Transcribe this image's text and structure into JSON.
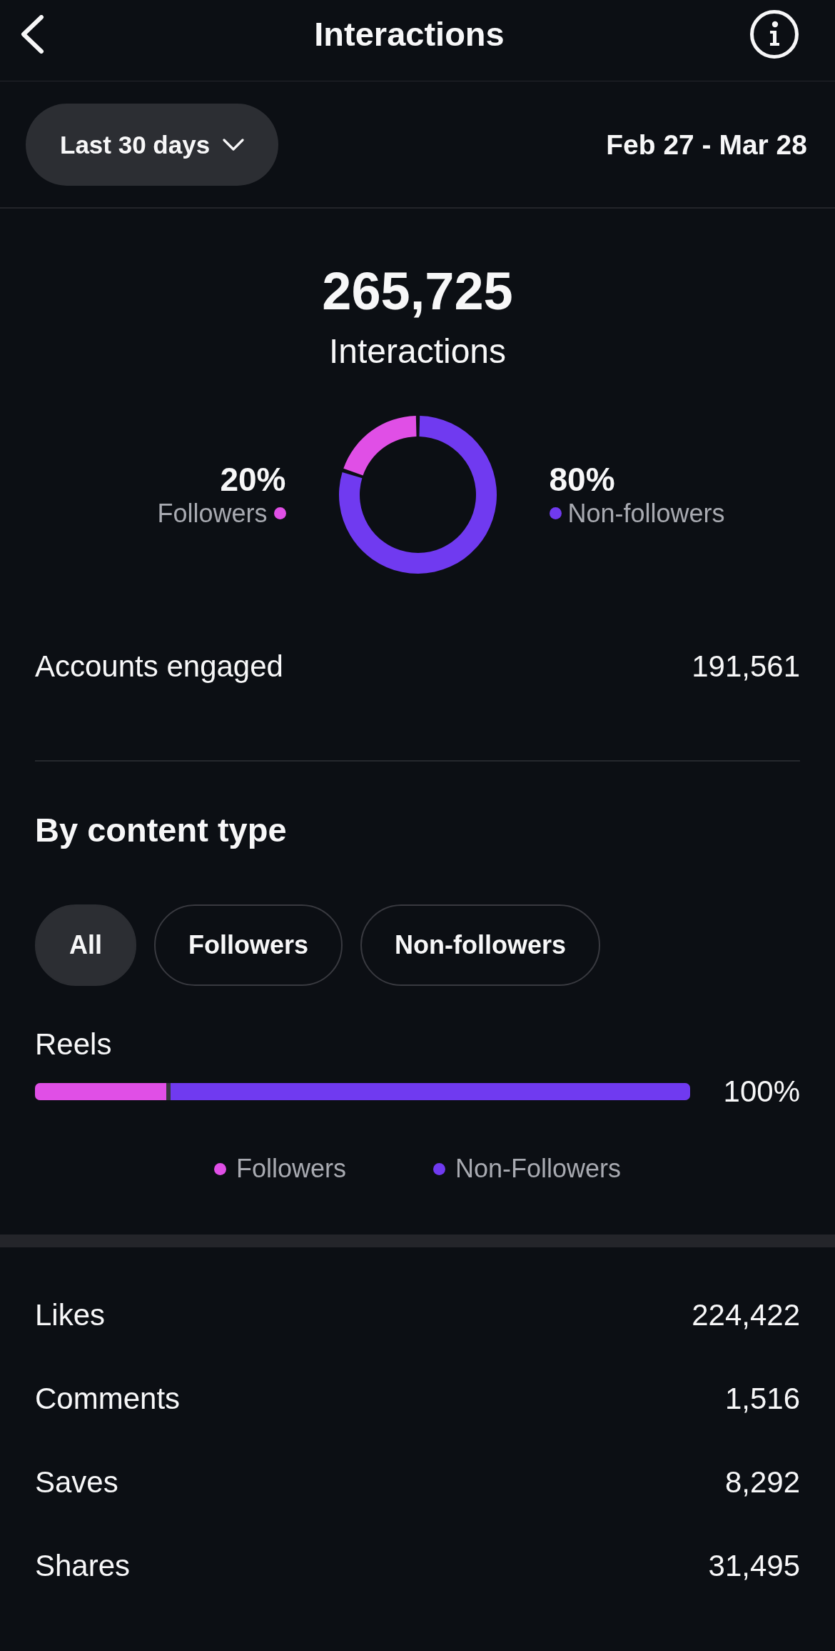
{
  "header": {
    "title": "Interactions"
  },
  "filter": {
    "range": "Last 30 days",
    "dates": "Feb 27 - Mar 28"
  },
  "summary": {
    "total": "265,725",
    "label": "Interactions",
    "chart_data": {
      "type": "donut",
      "categories": [
        "Followers",
        "Non-followers"
      ],
      "values": [
        20,
        80
      ]
    },
    "breakdown": [
      {
        "percent": "20%",
        "color": "#e04fe6"
      },
      {
        "percent": "80%",
        "color": "#703af0"
      }
    ]
  },
  "accounts_engaged": {
    "label": "Accounts engaged",
    "value": "191,561"
  },
  "content_type": {
    "title": "By content type",
    "chips": [
      {
        "label": "All",
        "selected": true
      },
      {
        "label": "Followers",
        "selected": false
      },
      {
        "label": "Non-followers",
        "selected": false
      }
    ],
    "bars": [
      {
        "label": "Reels",
        "reading": "100%",
        "segments": [
          {
            "level": 0.2
          },
          {
            "level": 0.8
          }
        ]
      }
    ],
    "legend": [
      {
        "label": "Followers",
        "color": "#e04fe6"
      },
      {
        "label": "Non-Followers",
        "color": "#703af0"
      }
    ]
  },
  "metrics": [
    {
      "label": "Likes",
      "value": "224,422"
    },
    {
      "label": "Comments",
      "value": "1,516"
    },
    {
      "label": "Saves",
      "value": "8,292"
    },
    {
      "label": "Shares",
      "value": "31,495"
    }
  ]
}
